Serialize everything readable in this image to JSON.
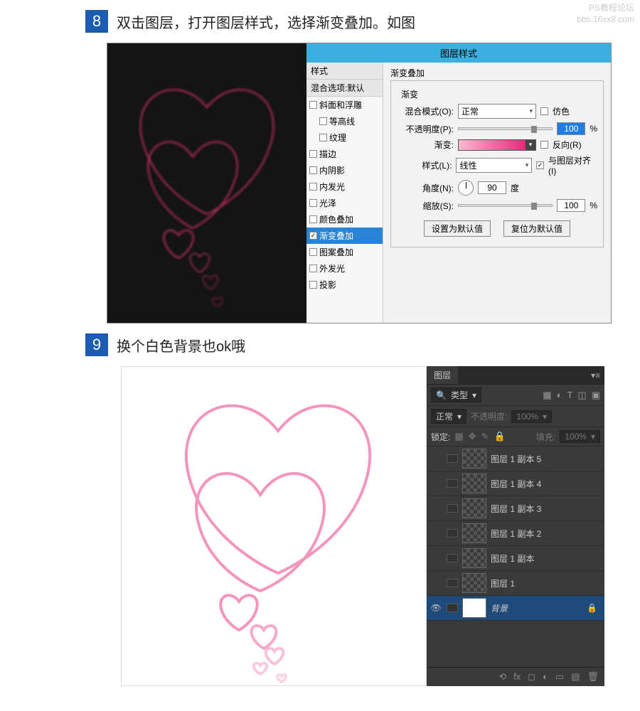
{
  "watermark": {
    "line1": "PS教程论坛",
    "line2": "bbs.16xx8.com"
  },
  "step8": {
    "num": "8",
    "text": "双击图层，打开图层样式，选择渐变叠加。如图",
    "dialog_title": "图层样式",
    "styles_header": "样式",
    "styles_blend": "混合选项:默认",
    "styles": [
      {
        "label": "斜面和浮雕",
        "checked": false,
        "indent": false
      },
      {
        "label": "等高线",
        "checked": false,
        "indent": true
      },
      {
        "label": "纹理",
        "checked": false,
        "indent": true
      },
      {
        "label": "描边",
        "checked": false,
        "indent": false
      },
      {
        "label": "内阴影",
        "checked": false,
        "indent": false
      },
      {
        "label": "内发光",
        "checked": false,
        "indent": false
      },
      {
        "label": "光泽",
        "checked": false,
        "indent": false
      },
      {
        "label": "颜色叠加",
        "checked": false,
        "indent": false
      },
      {
        "label": "渐变叠加",
        "checked": true,
        "indent": false,
        "selected": true
      },
      {
        "label": "图案叠加",
        "checked": false,
        "indent": false
      },
      {
        "label": "外发光",
        "checked": false,
        "indent": false
      },
      {
        "label": "投影",
        "checked": false,
        "indent": false
      }
    ],
    "panel": {
      "section_title": "渐变叠加",
      "group_title": "渐变",
      "blend_mode_label": "混合模式(O):",
      "blend_mode_value": "正常",
      "dither_label": "仿色",
      "opacity_label": "不透明度(P):",
      "opacity_value": "100",
      "opacity_unit": "%",
      "gradient_label": "渐变:",
      "reverse_label": "反向(R)",
      "style_label": "样式(L):",
      "style_value": "线性",
      "align_label": "与图层对齐(I)",
      "angle_label": "角度(N):",
      "angle_value": "90",
      "angle_unit": "度",
      "scale_label": "缩放(S):",
      "scale_value": "100",
      "scale_unit": "%",
      "btn_default": "设置为默认值",
      "btn_reset": "复位为默认值"
    }
  },
  "step9": {
    "num": "9",
    "text": "换个白色背景也ok哦",
    "panel": {
      "tab": "图层",
      "filter_icon": "🔍",
      "filter_value": "类型",
      "blend_value": "正常",
      "opacity_label": "不透明度:",
      "opacity_value": "100%",
      "lock_label": "锁定:",
      "fill_label": "填充:",
      "fill_value": "100%",
      "layers": [
        {
          "name": "图层 1 副本 5",
          "eye": false
        },
        {
          "name": "图层 1 副本 4",
          "eye": false
        },
        {
          "name": "图层 1 副本 3",
          "eye": false
        },
        {
          "name": "图层 1 副本 2",
          "eye": false
        },
        {
          "name": "图层 1 副本",
          "eye": false
        },
        {
          "name": "图层 1",
          "eye": false
        }
      ],
      "bg_layer": {
        "name": "背景",
        "eye": true,
        "locked": true
      }
    }
  }
}
